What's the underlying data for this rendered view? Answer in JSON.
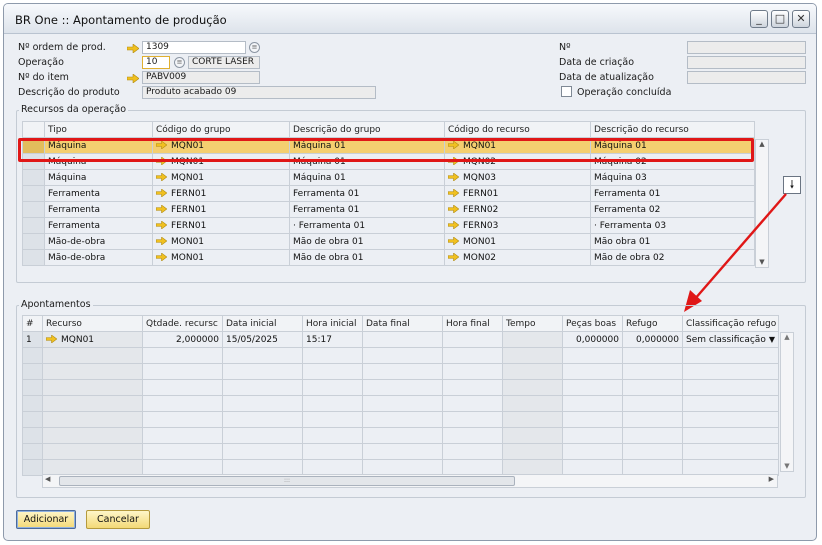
{
  "window": {
    "title": "BR One :: Apontamento de produção"
  },
  "header": {
    "ordem_label": "Nº ordem de prod.",
    "ordem_value": "1309",
    "operacao_label": "Operação",
    "operacao_value": "10",
    "operacao_desc": "CORTE LASER",
    "item_label": "Nº do item",
    "item_value": "PABV009",
    "descricao_label": "Descrição do produto",
    "descricao_value": "Produto acabado 09",
    "numero_label": "Nº",
    "criacao_label": "Data de criação",
    "atualizacao_label": "Data de atualização",
    "concluida_label": "Operação concluída"
  },
  "recursos": {
    "title": "Recursos da operação",
    "columns": [
      "Tipo",
      "Código do grupo",
      "Descrição do grupo",
      "Código do recurso",
      "Descrição do recurso"
    ],
    "rows": [
      [
        "Máquina",
        "MQN01",
        "Máquina 01",
        "MQN01",
        "Máquina 01"
      ],
      [
        "Máquina",
        "MQN01",
        "Máquina 01",
        "MQN02",
        "Máquina 02"
      ],
      [
        "Máquina",
        "MQN01",
        "Máquina 01",
        "MQN03",
        "Máquina 03"
      ],
      [
        "Ferramenta",
        "FERN01",
        "Ferramenta 01",
        "FERN01",
        "Ferramenta 01"
      ],
      [
        "Ferramenta",
        "FERN01",
        "Ferramenta 01",
        "FERN02",
        "Ferramenta 02"
      ],
      [
        "Ferramenta",
        "FERN01",
        "·      Ferramenta 01",
        "FERN03",
        "·      Ferramenta 03"
      ],
      [
        "Mão-de-obra",
        "MON01",
        "Mão de obra 01",
        "MON01",
        "Mão obra 01"
      ],
      [
        "Mão-de-obra",
        "MON01",
        "Mão de obra 01",
        "MON02",
        "Mão de obra 02"
      ]
    ]
  },
  "apontamentos": {
    "title": "Apontamentos",
    "columns": [
      "#",
      "Recurso",
      "Qtdade. recursc",
      "Data inicial",
      "Hora inicial",
      "Data final",
      "Hora final",
      "Tempo",
      "Peças boas",
      "Refugo",
      "Classificação refugo"
    ],
    "rows": [
      [
        "1",
        "MQN01",
        "2,000000",
        "15/05/2025",
        "15:17",
        "",
        "",
        "",
        "0,000000",
        "0,000000",
        "Sem classificação"
      ]
    ]
  },
  "buttons": {
    "add": "Adicionar",
    "cancel": "Cancelar"
  },
  "colors": {
    "selected_row": "#f4cf70",
    "highlight_border": "#e01717",
    "link_arrow": "#f0c020"
  }
}
